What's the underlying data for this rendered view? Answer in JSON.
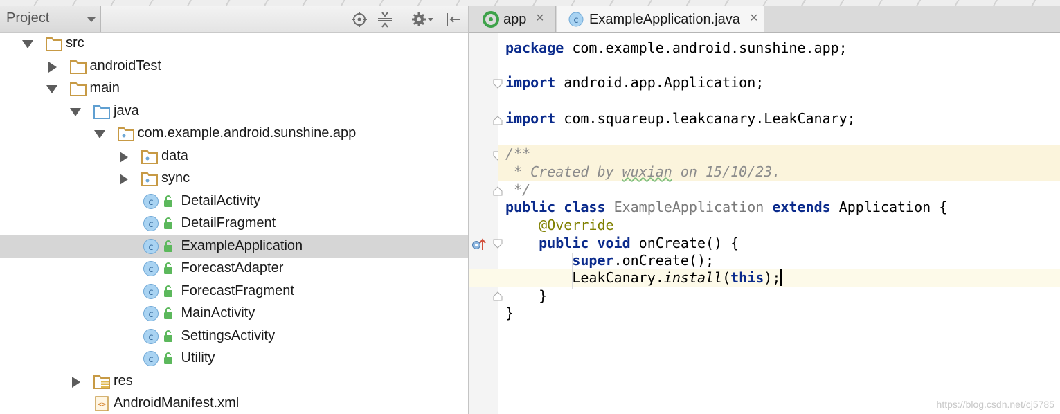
{
  "project_pane": {
    "view_selector": "Project",
    "toolbar_icons": [
      "target-icon",
      "collapse-icon",
      "gear-icon",
      "hide-icon"
    ]
  },
  "tree": [
    {
      "label": "src",
      "icon": "folder-icon",
      "arrow": "open"
    },
    {
      "label": "androidTest",
      "icon": "folder-icon",
      "arrow": "closed"
    },
    {
      "label": "main",
      "icon": "folder-icon",
      "arrow": "open"
    },
    {
      "label": "java",
      "icon": "source-folder-icon",
      "arrow": "open"
    },
    {
      "label": "com.example.android.sunshine.app",
      "icon": "package-icon",
      "arrow": "open"
    },
    {
      "label": "data",
      "icon": "package-icon",
      "arrow": "closed"
    },
    {
      "label": "sync",
      "icon": "package-icon",
      "arrow": "closed"
    },
    {
      "label": "DetailActivity",
      "icon": "class-icon"
    },
    {
      "label": "DetailFragment",
      "icon": "class-icon"
    },
    {
      "label": "ExampleApplication",
      "icon": "class-icon",
      "selected": true
    },
    {
      "label": "ForecastAdapter",
      "icon": "class-icon"
    },
    {
      "label": "ForecastFragment",
      "icon": "class-icon"
    },
    {
      "label": "MainActivity",
      "icon": "class-icon"
    },
    {
      "label": "SettingsActivity",
      "icon": "class-icon"
    },
    {
      "label": "Utility",
      "icon": "class-icon"
    },
    {
      "label": "res",
      "icon": "resource-folder-icon",
      "arrow": "closed"
    },
    {
      "label": "AndroidManifest.xml",
      "icon": "xml-file-icon"
    }
  ],
  "editor": {
    "tabs": [
      {
        "label": "app",
        "close": "×",
        "active": false
      },
      {
        "label": "ExampleApplication.java",
        "close": "×",
        "active": true
      }
    ],
    "code": {
      "package_kw": "package",
      "package_name": " com.example.android.sunshine.app;",
      "import_kw": "import",
      "import1": " android.app.Application;",
      "import2": " com.squareup.leakcanary.LeakCanary;",
      "doc_open": "/**",
      "doc_prefix": " * Created by ",
      "doc_author": "wuxian",
      "doc_suffix": " on 15/10/23.",
      "doc_close": " */",
      "public_kw": "public",
      "class_kw": "class",
      "class_name": "ExampleApplication",
      "extends_kw": "extends",
      "base_class": " Application {",
      "override": "@Override",
      "void_kw": "void",
      "method_sig": " onCreate() {",
      "super_kw": "super",
      "super_call": ".onCreate();",
      "lc_obj": "LeakCanary.",
      "lc_method": "install",
      "lc_paren_open": "(",
      "this_kw": "this",
      "lc_paren_close": ");",
      "method_close": "}",
      "class_close": "}"
    }
  },
  "watermark": "https://blog.csdn.net/cj5785",
  "colors": {
    "keyword": "#0b2b8c",
    "comment": "#8c8c8c",
    "annotation": "#808000",
    "selection": "#d6d6d6",
    "doc_band": "#fbf4dc",
    "class_icon": "#a9d3f2",
    "folder_icon": "#d9b46a"
  }
}
